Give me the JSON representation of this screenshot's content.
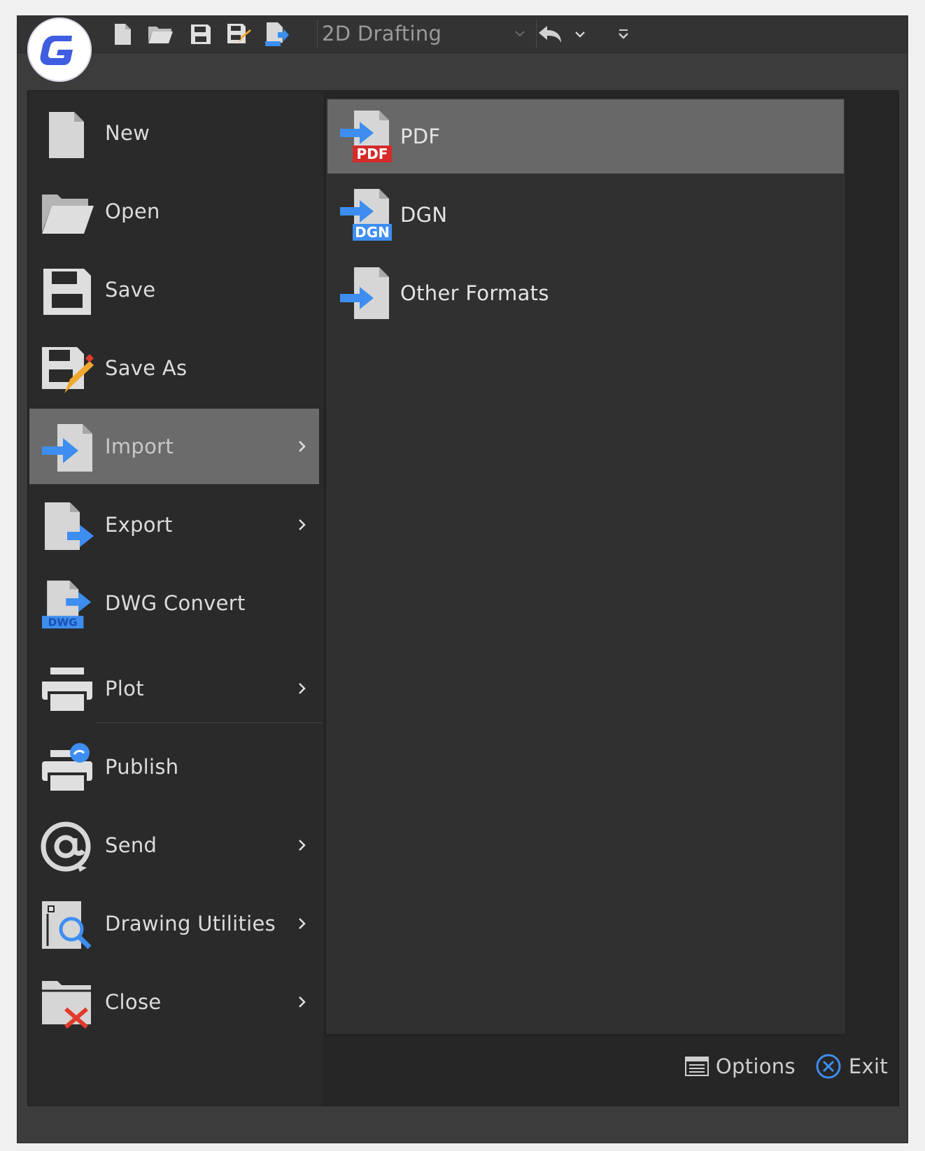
{
  "quick_access": {
    "workspace": "2D Drafting"
  },
  "menu": {
    "items": [
      {
        "label": "New"
      },
      {
        "label": "Open"
      },
      {
        "label": "Save"
      },
      {
        "label": "Save As"
      },
      {
        "label": "Import"
      },
      {
        "label": "Export"
      },
      {
        "label": "DWG Convert"
      },
      {
        "label": "Plot"
      },
      {
        "label": "Publish"
      },
      {
        "label": "Send"
      },
      {
        "label": "Drawing Utilities"
      },
      {
        "label": "Close"
      }
    ]
  },
  "submenu": {
    "items": [
      {
        "label": "PDF",
        "badge": "PDF"
      },
      {
        "label": "DGN",
        "badge": "DGN"
      },
      {
        "label": "Other Formats"
      }
    ]
  },
  "dwg_badge": "DWG",
  "footer": {
    "options": "Options",
    "exit": "Exit"
  },
  "colors": {
    "accent_blue": "#3d8ef0",
    "pdf_red": "#d42b2b",
    "logo_blue": "#3f5de0"
  }
}
